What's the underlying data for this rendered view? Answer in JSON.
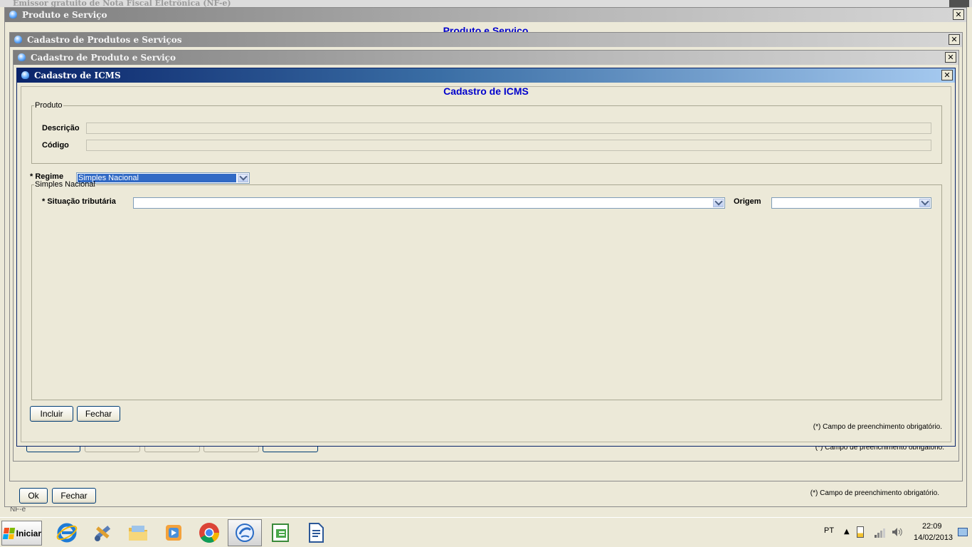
{
  "background_app": {
    "title": "Emissor gratuito de Nota Fiscal Eletrônica (NF-e)",
    "status_text": "NF-e"
  },
  "windows": {
    "produto_servico": {
      "title": "Produto e Serviço",
      "heading": "Produto e Serviço",
      "ok_label": "Ok",
      "fechar_label": "Fechar",
      "note": "(*) Campo de preenchimento obrigatório."
    },
    "cadastro_produtos_servicos": {
      "title": "Cadastro de Produtos e Serviços"
    },
    "cadastro_produto_servico": {
      "title": "Cadastro de Produto e Serviço",
      "note": "(*) Campo de preenchimento obrigatório."
    },
    "cadastro_icms": {
      "title": "Cadastro de ICMS",
      "heading": "Cadastro de ICMS",
      "produto_group": {
        "legend": "Produto",
        "descricao_label": "Descrição",
        "descricao_value": "",
        "codigo_label": "Código",
        "codigo_value": ""
      },
      "regime": {
        "label": "* Regime",
        "selected": "Simples Nacional"
      },
      "simples_group": {
        "legend": "Simples Nacional",
        "situacao_label": "* Situação tributária",
        "situacao_value": "",
        "origem_label": "Origem",
        "origem_value": ""
      },
      "buttons": {
        "incluir": "Incluir",
        "fechar": "Fechar"
      },
      "note": "(*) Campo de preenchimento obrigatório."
    }
  },
  "close_glyph": "✕",
  "taskbar": {
    "start_label": "Iniciar",
    "apps": [
      {
        "icon": "internet-explorer-icon"
      },
      {
        "icon": "tools-icon"
      },
      {
        "icon": "folder-icon"
      },
      {
        "icon": "media-player-icon"
      },
      {
        "icon": "chrome-icon"
      },
      {
        "icon": "nfe-emissor-icon",
        "active": true
      },
      {
        "icon": "spreadsheet-icon"
      },
      {
        "icon": "document-icon"
      }
    ],
    "language": "PT",
    "time": "22:09",
    "date": "14/02/2013"
  },
  "colors": {
    "accent_title": "#0000cc",
    "active_title_start": "#0a246a",
    "active_title_end": "#a6caf0",
    "selection": "#316ac5"
  }
}
